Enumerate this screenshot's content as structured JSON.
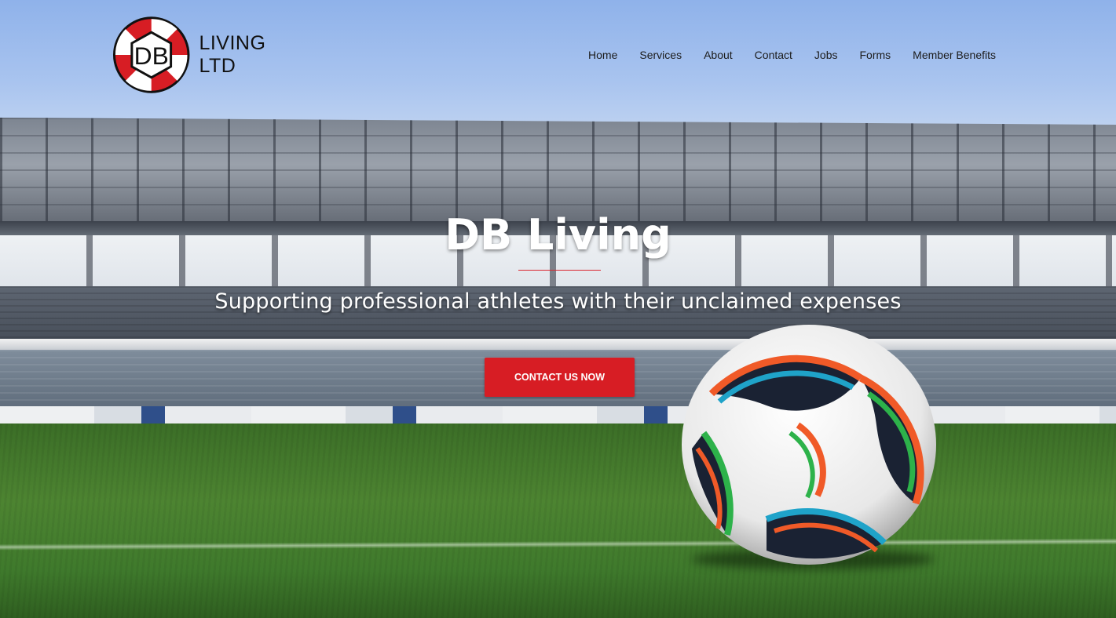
{
  "logo": {
    "mark_text": "DB",
    "wordmark": "LIVING LTD"
  },
  "nav": {
    "items": [
      {
        "label": "Home"
      },
      {
        "label": "Services"
      },
      {
        "label": "About"
      },
      {
        "label": "Contact"
      },
      {
        "label": "Jobs"
      },
      {
        "label": "Forms"
      },
      {
        "label": "Member Benefits"
      }
    ]
  },
  "hero": {
    "title": "DB Living",
    "subtitle": "Supporting professional athletes with their unclaimed expenses",
    "cta_label": "CONTACT US NOW",
    "background": "football-stadium-photo"
  },
  "colors": {
    "brand_red": "#d71d24",
    "divider_red": "#d9262e",
    "nav_text": "#1c1c1c",
    "hero_text": "#ffffff"
  }
}
